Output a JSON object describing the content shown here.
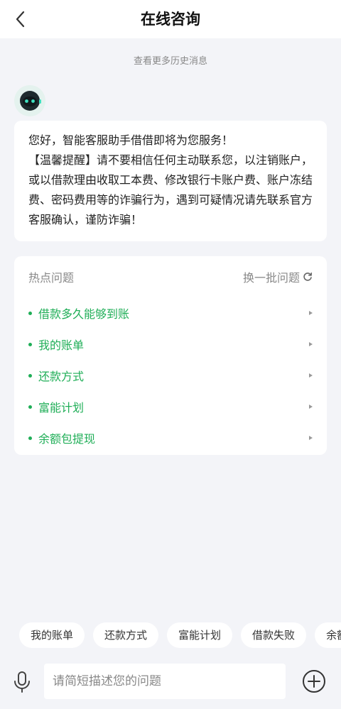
{
  "header": {
    "title": "在线咨询"
  },
  "history": {
    "label": "查看更多历史消息"
  },
  "message": {
    "paragraph1": "您好，智能客服助手借借即将为您服务！",
    "paragraph2": "【温馨提醒】请不要相信任何主动联系您，以注销账户，或以借款理由收取工本费、修改银行卡账户费、账户冻结费、密码费用等的诈骗行为，遇到可疑情况请先联系官方客服确认，谨防诈骗！"
  },
  "hot_questions": {
    "title": "热点问题",
    "refresh_label": "换一批问题",
    "items": [
      {
        "label": "借款多久能够到账"
      },
      {
        "label": "我的账单"
      },
      {
        "label": "还款方式"
      },
      {
        "label": "富能计划"
      },
      {
        "label": "余额包提现"
      }
    ]
  },
  "quick_chips": [
    {
      "label": "我的账单"
    },
    {
      "label": "还款方式"
    },
    {
      "label": "富能计划"
    },
    {
      "label": "借款失败"
    },
    {
      "label": "余额"
    }
  ],
  "input": {
    "placeholder": "请简短描述您的问题"
  },
  "colors": {
    "accent": "#1fae57",
    "background": "#f3f4f8"
  },
  "icons": {
    "back": "chevron-left-icon",
    "avatar": "robot-avatar-icon",
    "refresh": "refresh-icon",
    "mic": "microphone-icon",
    "plus": "plus-circle-icon"
  }
}
